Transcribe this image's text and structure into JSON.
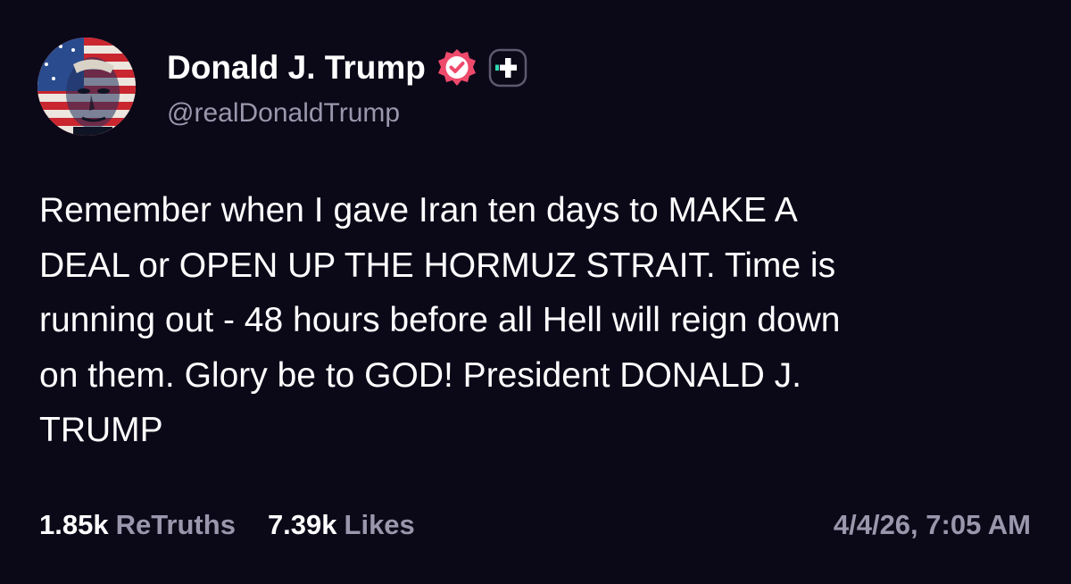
{
  "profile": {
    "display_name": "Donald J. Trump",
    "handle": "@realDonaldTrump",
    "avatar_icon": "flag-portrait-avatar",
    "verified_icon": "verified-badge-icon",
    "plus_icon": "truth-plus-badge-icon"
  },
  "post": {
    "lines": [
      "Remember when I gave Iran ten days to MAKE A",
      "DEAL or OPEN UP THE HORMUZ STRAIT. Time is",
      "running out - 48 hours before all Hell will reign down",
      "on them. Glory be to GOD! President DONALD J.",
      "TRUMP"
    ]
  },
  "stats": {
    "retruths_count": "1.85k",
    "retruths_label": "ReTruths",
    "likes_count": "7.39k",
    "likes_label": "Likes"
  },
  "timestamp": "4/4/26, 7:05 AM",
  "colors": {
    "background": "#0b0818",
    "text_primary": "#ffffff",
    "text_secondary": "#9a97ad",
    "verified_badge": "#ee4a6b",
    "plus_accent": "#2fd8b3"
  }
}
